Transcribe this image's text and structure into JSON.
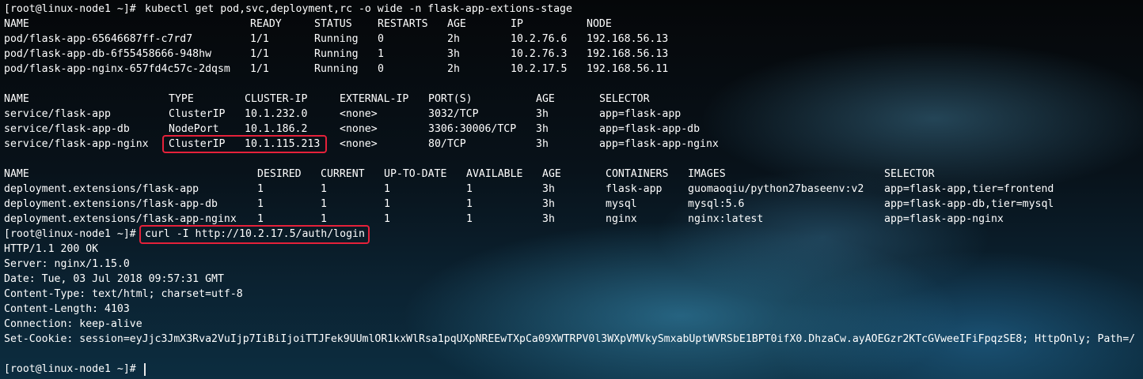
{
  "prompt": "[root@linux-node1 ~]#",
  "cmd1": "kubectl get pod,svc,deployment,rc -o wide -n flask-app-extions-stage",
  "pods": {
    "headers": [
      "NAME",
      "READY",
      "STATUS",
      "RESTARTS",
      "AGE",
      "IP",
      "NODE"
    ],
    "rows": [
      [
        "pod/flask-app-65646687ff-c7rd7",
        "1/1",
        "Running",
        "0",
        "2h",
        "10.2.76.6",
        "192.168.56.13"
      ],
      [
        "pod/flask-app-db-6f55458666-948hw",
        "1/1",
        "Running",
        "1",
        "3h",
        "10.2.76.3",
        "192.168.56.13"
      ],
      [
        "pod/flask-app-nginx-657fd4c57c-2dqsm",
        "1/1",
        "Running",
        "0",
        "2h",
        "10.2.17.5",
        "192.168.56.11"
      ]
    ]
  },
  "services": {
    "headers": [
      "NAME",
      "TYPE",
      "CLUSTER-IP",
      "EXTERNAL-IP",
      "PORT(S)",
      "AGE",
      "SELECTOR"
    ],
    "rows": [
      [
        "service/flask-app",
        "ClusterIP",
        "10.1.232.0",
        "<none>",
        "3032/TCP",
        "3h",
        "app=flask-app"
      ],
      [
        "service/flask-app-db",
        "NodePort",
        "10.1.186.2",
        "<none>",
        "3306:30006/TCP",
        "3h",
        "app=flask-app-db"
      ],
      [
        "service/flask-app-nginx",
        "ClusterIP",
        "10.1.115.213",
        "<none>",
        "80/TCP",
        "3h",
        "app=flask-app-nginx"
      ]
    ]
  },
  "deployments": {
    "headers": [
      "NAME",
      "DESIRED",
      "CURRENT",
      "UP-TO-DATE",
      "AVAILABLE",
      "AGE",
      "CONTAINERS",
      "IMAGES",
      "SELECTOR"
    ],
    "rows": [
      [
        "deployment.extensions/flask-app",
        "1",
        "1",
        "1",
        "1",
        "3h",
        "flask-app",
        "guomaoqiu/python27baseenv:v2",
        "app=flask-app,tier=frontend"
      ],
      [
        "deployment.extensions/flask-app-db",
        "1",
        "1",
        "1",
        "1",
        "3h",
        "mysql",
        "mysql:5.6",
        "app=flask-app-db,tier=mysql"
      ],
      [
        "deployment.extensions/flask-app-nginx",
        "1",
        "1",
        "1",
        "1",
        "3h",
        "nginx",
        "nginx:latest",
        "app=flask-app-nginx"
      ]
    ]
  },
  "cmd2": "curl -I http://10.2.17.5/auth/login",
  "response": [
    "HTTP/1.1 200 OK",
    "Server: nginx/1.15.0",
    "Date: Tue, 03 Jul 2018 09:57:31 GMT",
    "Content-Type: text/html; charset=utf-8",
    "Content-Length: 4103",
    "Connection: keep-alive",
    "Set-Cookie: session=eyJjc3JmX3Rva2VuIjp7IiBiIjoiTTJFek9UUmlOR1kxWlRsa1pqUXpNREEwTXpCa09XWTRPV0l3WXpVMVkySmxabUptWVRSbE1BPT0ifX0.DhzaCw.ayAOEGzr2KTcGVweeIFiFpqzSE8; HttpOnly; Path=/"
  ],
  "colors": {
    "highlight": "#e5213a",
    "text": "#ffffff"
  }
}
